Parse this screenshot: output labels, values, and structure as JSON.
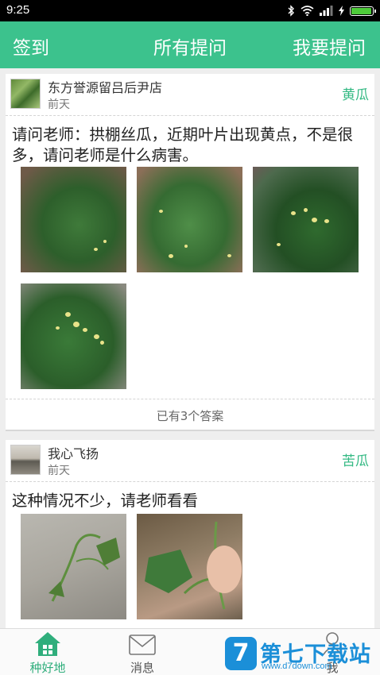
{
  "statusbar": {
    "time": "9:25"
  },
  "topbar": {
    "checkin": "签到",
    "title": "所有提问",
    "ask": "我要提问"
  },
  "posts": [
    {
      "user": "东方誉源留吕后尹店",
      "time": "前天",
      "crop": "黄瓜",
      "question": "请问老师：拱棚丝瓜，近期叶片出现黄点，不是很多，请问老师是什么病害。",
      "answers": "已有3个答案"
    },
    {
      "user": "我心飞扬",
      "time": "前天",
      "crop": "苦瓜",
      "question": "这种情况不少，请老师看看"
    }
  ],
  "tabs": [
    {
      "label": "种好地"
    },
    {
      "label": "消息"
    },
    {
      "label": "我"
    }
  ],
  "watermark": {
    "title": "第七下载站",
    "url": "www.d7down.com",
    "badge": "7"
  },
  "colors": {
    "primary": "#3cc28d",
    "crop_tag": "#33b983",
    "watermark": "#1b8fd8"
  }
}
